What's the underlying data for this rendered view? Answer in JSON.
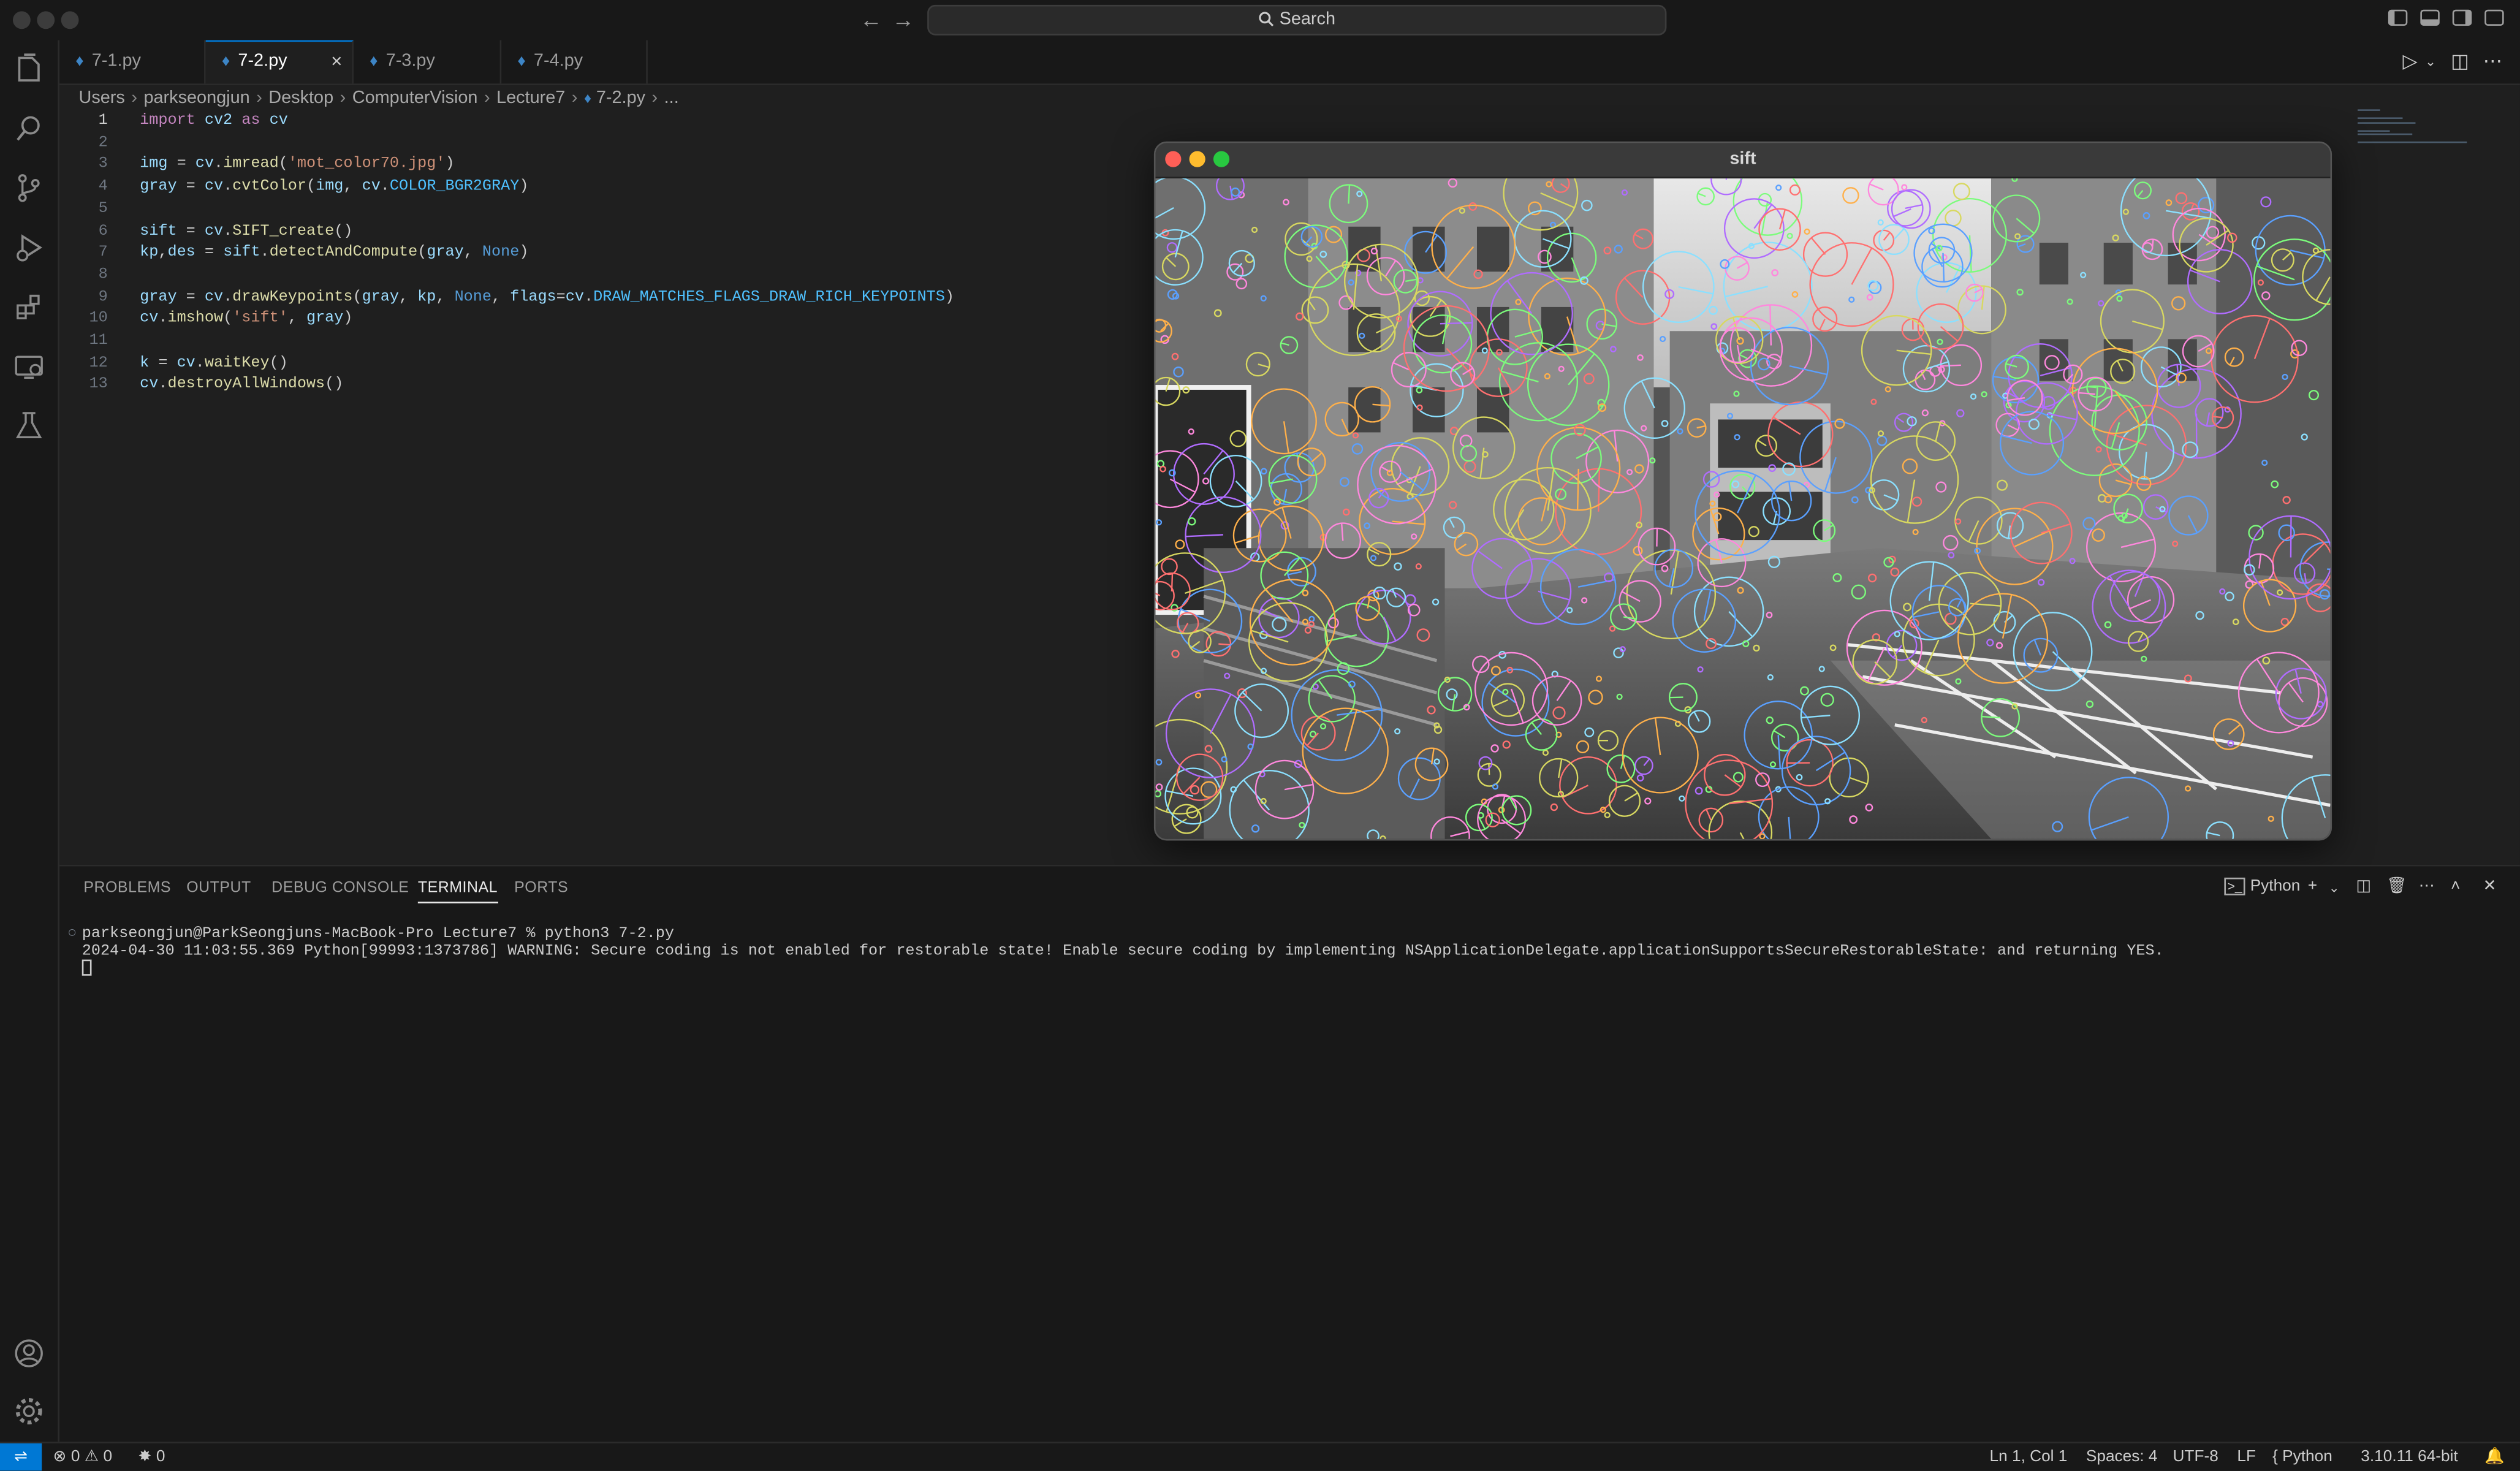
{
  "titlebar": {
    "search_placeholder": "Search",
    "back_icon": "arrow-left-icon",
    "forward_icon": "arrow-right-icon"
  },
  "activity_bar": {
    "items": [
      "explorer-icon",
      "search-icon",
      "source-control-icon",
      "run-debug-icon",
      "extensions-icon",
      "remote-explorer-icon",
      "testing-icon"
    ],
    "bottom": [
      "accounts-icon",
      "manage-gear-icon"
    ]
  },
  "tabs": [
    {
      "label": "7-1.py",
      "active": false
    },
    {
      "label": "7-2.py",
      "active": true
    },
    {
      "label": "7-3.py",
      "active": false
    },
    {
      "label": "7-4.py",
      "active": false
    }
  ],
  "tab_close": "×",
  "breadcrumb": [
    "Users",
    "parkseongjun",
    "Desktop",
    "ComputerVision",
    "Lecture7",
    "7-2.py",
    "..."
  ],
  "code": {
    "line_numbers": [
      "1",
      "2",
      "3",
      "4",
      "5",
      "6",
      "7",
      "8",
      "9",
      "10",
      "11",
      "12",
      "13"
    ],
    "current_line": "1",
    "lines": [
      "import cv2 as cv",
      "",
      "img = cv.imread('mot_color70.jpg')",
      "gray = cv.cvtColor(img, cv.COLOR_BGR2GRAY)",
      "",
      "sift = cv.SIFT_create()",
      "kp,des = sift.detectAndCompute(gray, None)",
      "",
      "gray = cv.drawKeypoints(gray, kp, None, flags=cv.DRAW_MATCHES_FLAGS_DRAW_RICH_KEYPOINTS)",
      "cv.imshow('sift', gray)",
      "",
      "k = cv.waitKey()",
      "cv.destroyAllWindows()"
    ]
  },
  "sift_window": {
    "title": "sift",
    "close_color": "#ff5f57",
    "minimize_color": "#febc2e",
    "zoom_color": "#28c840"
  },
  "panel": {
    "tabs": [
      "PROBLEMS",
      "OUTPUT",
      "DEBUG CONSOLE",
      "TERMINAL",
      "PORTS"
    ],
    "active_tab": "TERMINAL",
    "shell_label": "Python",
    "terminal_lines": [
      "parkseongjun@ParkSeongjuns-MacBook-Pro Lecture7 % python3 7-2.py",
      "2024-04-30 11:03:55.369 Python[99993:1373786] WARNING: Secure coding is not enabled for restorable state! Enable secure coding by implementing NSApplicationDelegate.applicationSupportsSecureRestorableState: and returning YES."
    ]
  },
  "statusbar": {
    "errors": "0",
    "warnings": "0",
    "ports": "0",
    "position": "Ln 1, Col 1",
    "spaces": "Spaces: 4",
    "encoding": "UTF-8",
    "eol": "LF",
    "language": "Python",
    "interpreter": "3.10.11 64-bit"
  },
  "colors": {
    "accent": "#0078d4",
    "editor_bg": "#1f1f1f",
    "sidebar_bg": "#181818"
  }
}
